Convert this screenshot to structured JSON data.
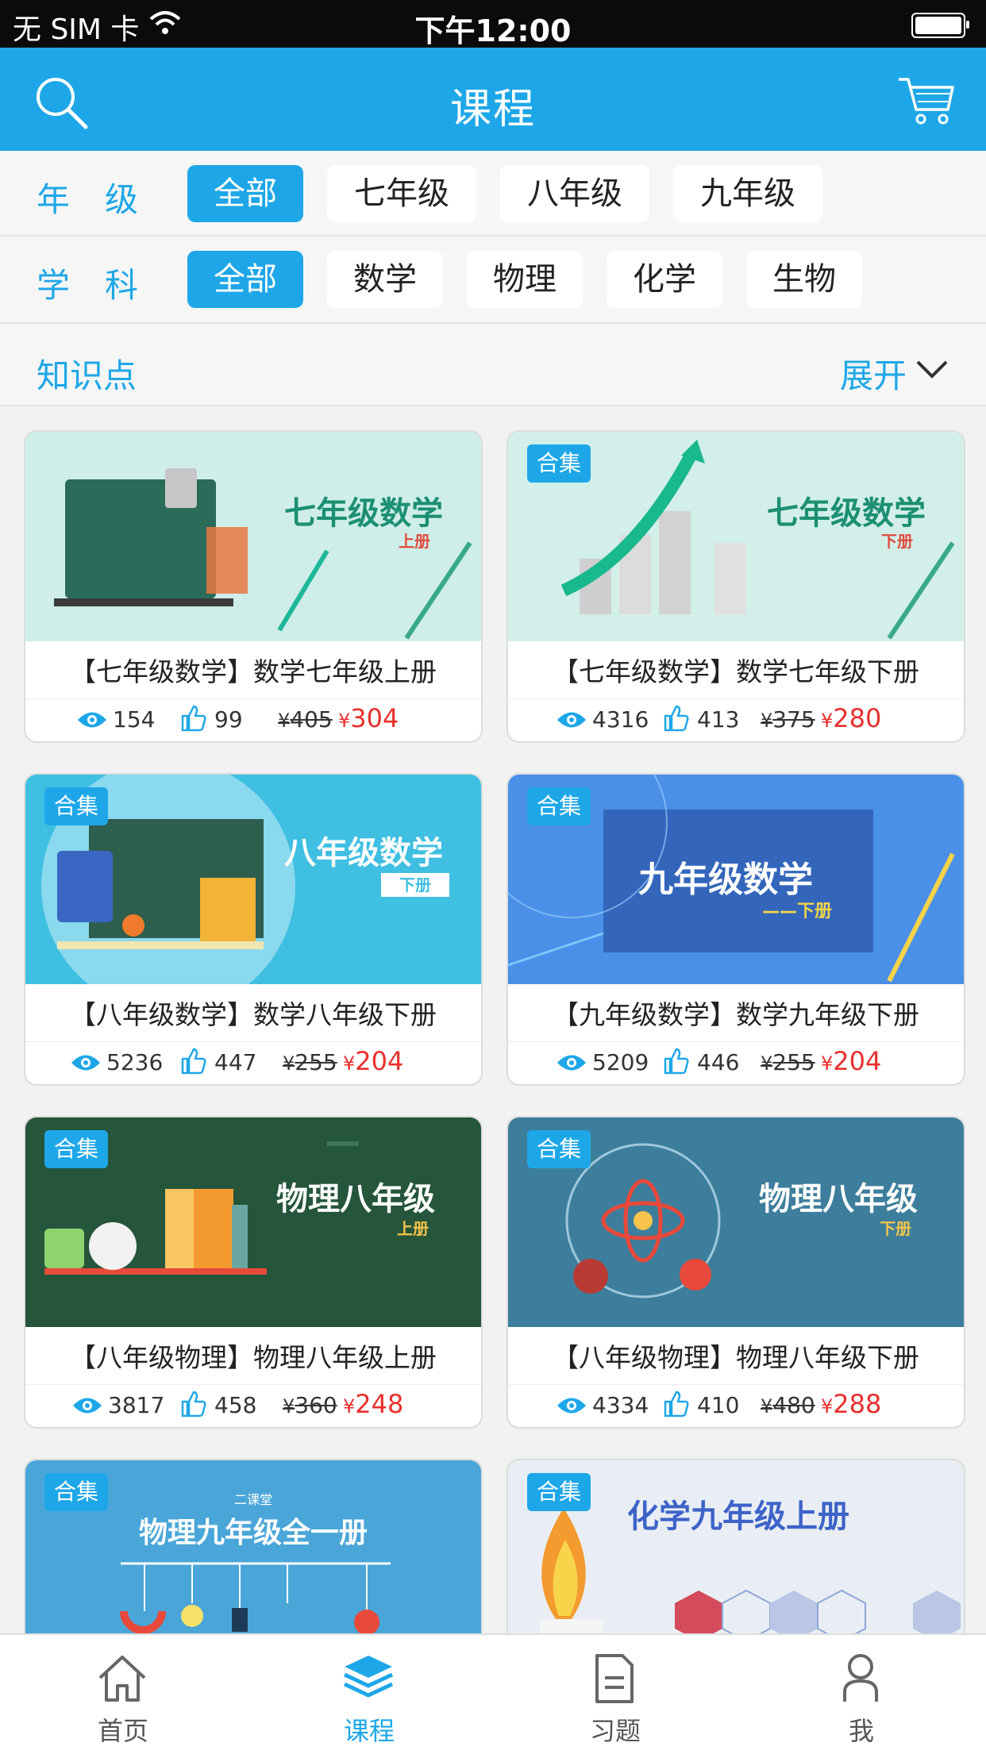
{
  "status_bar": {
    "carrier": "无 SIM 卡",
    "time": "下午12:00"
  },
  "navbar": {
    "title": "课程",
    "left_icon": "search-icon",
    "right_icon": "cart-icon"
  },
  "filters": {
    "grade": {
      "label": "年级",
      "options": [
        "全部",
        "七年级",
        "八年级",
        "九年级"
      ],
      "selected": "全部"
    },
    "subject": {
      "label": "学科",
      "options": [
        "全部",
        "数学",
        "物理",
        "化学",
        "生物"
      ],
      "selected": "全部"
    },
    "knowledge": {
      "label": "知识点",
      "expand": "展开"
    }
  },
  "courses": [
    {
      "tag": "",
      "thumb_title": "七年级数学",
      "thumb_sub": "上册",
      "title": "【七年级数学】数学七年级上册",
      "views": "154",
      "likes": "99",
      "old_price": "405",
      "price": "304",
      "bg": "#cfeee9"
    },
    {
      "tag": "合集",
      "thumb_title": "七年级数学",
      "thumb_sub": "下册",
      "title": "【七年级数学】数学七年级下册",
      "views": "4316",
      "likes": "413",
      "old_price": "375",
      "price": "280",
      "bg": "#d3efea"
    },
    {
      "tag": "合集",
      "thumb_title": "八年级数学",
      "thumb_sub": "下册",
      "title": "【八年级数学】数学八年级下册",
      "views": "5236",
      "likes": "447",
      "old_price": "255",
      "price": "204",
      "bg": "#3fbfe2"
    },
    {
      "tag": "合集",
      "thumb_title": "九年级数学",
      "thumb_sub": "——下册",
      "title": "【九年级数学】数学九年级下册",
      "views": "5209",
      "likes": "446",
      "old_price": "255",
      "price": "204",
      "bg": "#4a8fe8"
    },
    {
      "tag": "合集",
      "thumb_title": "物理八年级",
      "thumb_sub": "上册",
      "title": "【八年级物理】物理八年级上册",
      "views": "3817",
      "likes": "458",
      "old_price": "360",
      "price": "248",
      "bg": "#25553a"
    },
    {
      "tag": "合集",
      "thumb_title": "物理八年级",
      "thumb_sub": "下册",
      "title": "【八年级物理】物理八年级下册",
      "views": "4334",
      "likes": "410",
      "old_price": "480",
      "price": "288",
      "bg": "#3d7e9c"
    },
    {
      "tag": "合集",
      "thumb_title": "物理九年级全一册",
      "thumb_sub": "二课堂",
      "title": "",
      "views": "",
      "likes": "",
      "old_price": "",
      "price": "",
      "bg": "#4aa6d8"
    },
    {
      "tag": "合集",
      "thumb_title": "化学九年级上册",
      "thumb_sub": "",
      "title": "",
      "views": "",
      "likes": "",
      "old_price": "",
      "price": "",
      "bg": "#e9eef4"
    }
  ],
  "currency": "¥",
  "tabbar": [
    {
      "label": "首页",
      "icon": "home-icon"
    },
    {
      "label": "课程",
      "icon": "layers-icon",
      "active": true
    },
    {
      "label": "习题",
      "icon": "document-icon"
    },
    {
      "label": "我",
      "icon": "person-icon"
    }
  ],
  "colors": {
    "accent": "#1ea7e8",
    "price": "#e8302d"
  }
}
